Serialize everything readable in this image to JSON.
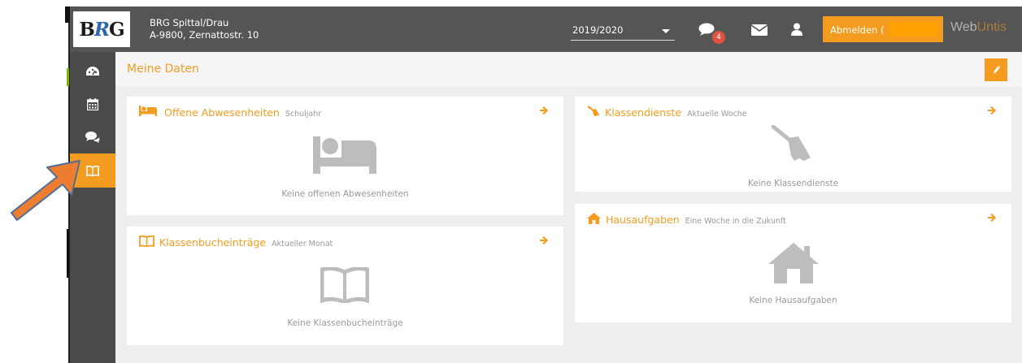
{
  "header": {
    "school_name": "BRG Spittal/Drau",
    "school_address": "A-9800, Zernattostr. 10",
    "school_year": "2019/2020",
    "message_count": "4",
    "logout_label": "Abmelden (",
    "brand_web": "Web",
    "brand_untis": "Untis"
  },
  "sidebar": {
    "items": [
      {
        "icon": "dashboard-icon",
        "active": false
      },
      {
        "icon": "calendar-icon",
        "active": false
      },
      {
        "icon": "chat-icon",
        "active": false
      },
      {
        "icon": "book-icon",
        "active": true
      }
    ]
  },
  "page": {
    "title": "Meine Daten"
  },
  "cards": {
    "absences": {
      "title": "Offene Abwesenheiten",
      "subtitle": "Schuljahr",
      "empty": "Keine offenen Abwesenheiten",
      "icon": "bed-icon"
    },
    "classbook": {
      "title": "Klassenbucheinträge",
      "subtitle": "Aktueller Monat",
      "empty": "Keine Klassenbucheinträge",
      "icon": "book-icon"
    },
    "duties": {
      "title": "Klassendienste",
      "subtitle": "Aktuelle Woche",
      "empty": "Keine Klassendienste",
      "icon": "broom-icon"
    },
    "homework": {
      "title": "Hausaufgaben",
      "subtitle": "Eine Woche in die Zukunft",
      "empty": "Keine Hausaufgaben",
      "icon": "house-icon"
    }
  },
  "colors": {
    "accent": "#f39c1f",
    "topbar": "#555555",
    "sidebar": "#4a4a4a",
    "annotation_arrow": "#ed7d31"
  }
}
